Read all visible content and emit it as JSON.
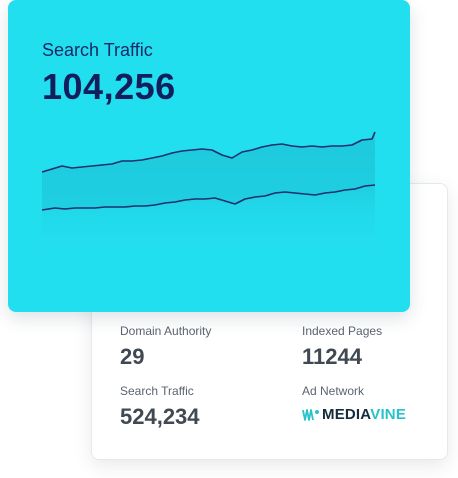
{
  "traffic_card": {
    "title": "Search Traffic",
    "value": "104,256"
  },
  "stats": [
    {
      "label": "Domain Authority",
      "value": "29"
    },
    {
      "label": "Indexed Pages",
      "value": "11244"
    },
    {
      "label": "Search Traffic",
      "value": "524,234"
    },
    {
      "label": "Ad Network",
      "logo_text_1": "MEDIA",
      "logo_text_2": "VINE"
    }
  ],
  "colors": {
    "card_bg": "#22dff0",
    "title": "#1a2a66",
    "line": "#1e2f6e",
    "logo_dark": "#172b3a",
    "logo_teal": "#27c2cc"
  }
}
